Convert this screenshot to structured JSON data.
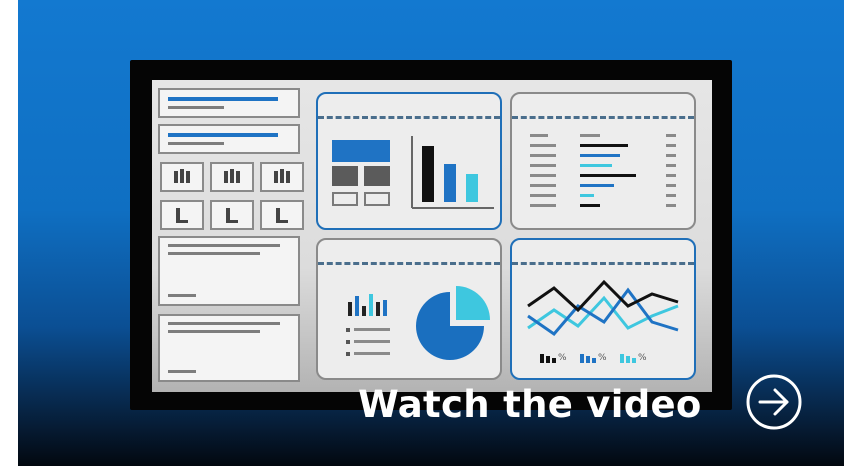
{
  "banner": {
    "cta_label": "Watch the video",
    "arrow_icon": "arrow-right-circle-icon",
    "accent_color": "#1f73c4"
  },
  "mini_chart_legend": {
    "labels": [
      "%",
      "%",
      "%"
    ]
  }
}
